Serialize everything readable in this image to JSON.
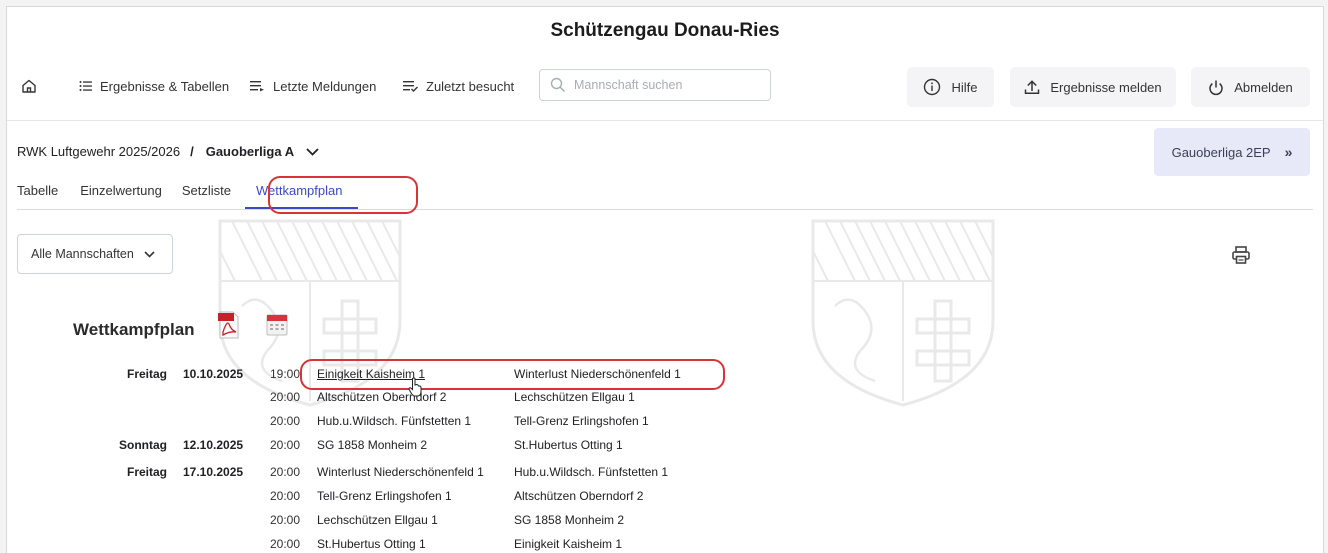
{
  "header": {
    "title": "Schützengau Donau-Ries"
  },
  "nav": {
    "home_icon": "home-icon",
    "items": [
      {
        "label": "Ergebnisse & Tabellen",
        "icon": "list-icon"
      },
      {
        "label": "Letzte Meldungen",
        "icon": "list-arrow-icon"
      },
      {
        "label": "Zuletzt besucht",
        "icon": "list-check-icon"
      }
    ],
    "search_placeholder": "Mannschaft suchen",
    "right": [
      {
        "label": "Hilfe",
        "icon": "info-icon"
      },
      {
        "label": "Ergebnisse melden",
        "icon": "upload-icon"
      },
      {
        "label": "Abmelden",
        "icon": "power-icon"
      }
    ]
  },
  "breadcrumb": {
    "season": "RWK Luftgewehr 2025/2026",
    "separator": "/",
    "league": "Gauoberliga A"
  },
  "next_league": {
    "label": "Gauoberliga 2EP",
    "icon": "double-chevron-right-icon"
  },
  "tabs": [
    {
      "label": "Tabelle"
    },
    {
      "label": "Einzelwertung"
    },
    {
      "label": "Setzliste"
    },
    {
      "label": "Wettkampfplan",
      "active": true
    }
  ],
  "filter": {
    "label": "Alle Mannschaften"
  },
  "plan": {
    "title": "Wettkampfplan",
    "matches": [
      {
        "day": "Freitag",
        "date": "10.10.2025",
        "time": "19:00",
        "home": "Einigkeit Kaisheim 1",
        "away": "Winterlust Niederschönenfeld 1"
      },
      {
        "day": "",
        "date": "",
        "time": "20:00",
        "home": "Altschützen Oberndorf 2",
        "away": "Lechschützen Ellgau 1"
      },
      {
        "day": "",
        "date": "",
        "time": "20:00",
        "home": "Hub.u.Wildsch. Fünfstetten 1",
        "away": "Tell-Grenz Erlingshofen 1"
      },
      {
        "day": "Sonntag",
        "date": "12.10.2025",
        "time": "20:00",
        "home": "SG 1858 Monheim 2",
        "away": "St.Hubertus Otting 1"
      },
      {
        "day": "Freitag",
        "date": "17.10.2025",
        "time": "20:00",
        "home": "Winterlust Niederschönenfeld 1",
        "away": "Hub.u.Wildsch. Fünfstetten 1"
      },
      {
        "day": "",
        "date": "",
        "time": "20:00",
        "home": "Tell-Grenz Erlingshofen 1",
        "away": "Altschützen Oberndorf 2"
      },
      {
        "day": "",
        "date": "",
        "time": "20:00",
        "home": "Lechschützen Ellgau 1",
        "away": "SG 1858 Monheim 2"
      },
      {
        "day": "",
        "date": "",
        "time": "20:00",
        "home": "St.Hubertus Otting 1",
        "away": "Einigkeit Kaisheim 1"
      }
    ]
  },
  "colors": {
    "accent": "#3a49c8",
    "highlight": "#d9333a",
    "next_button_bg": "#e8e9f8"
  }
}
